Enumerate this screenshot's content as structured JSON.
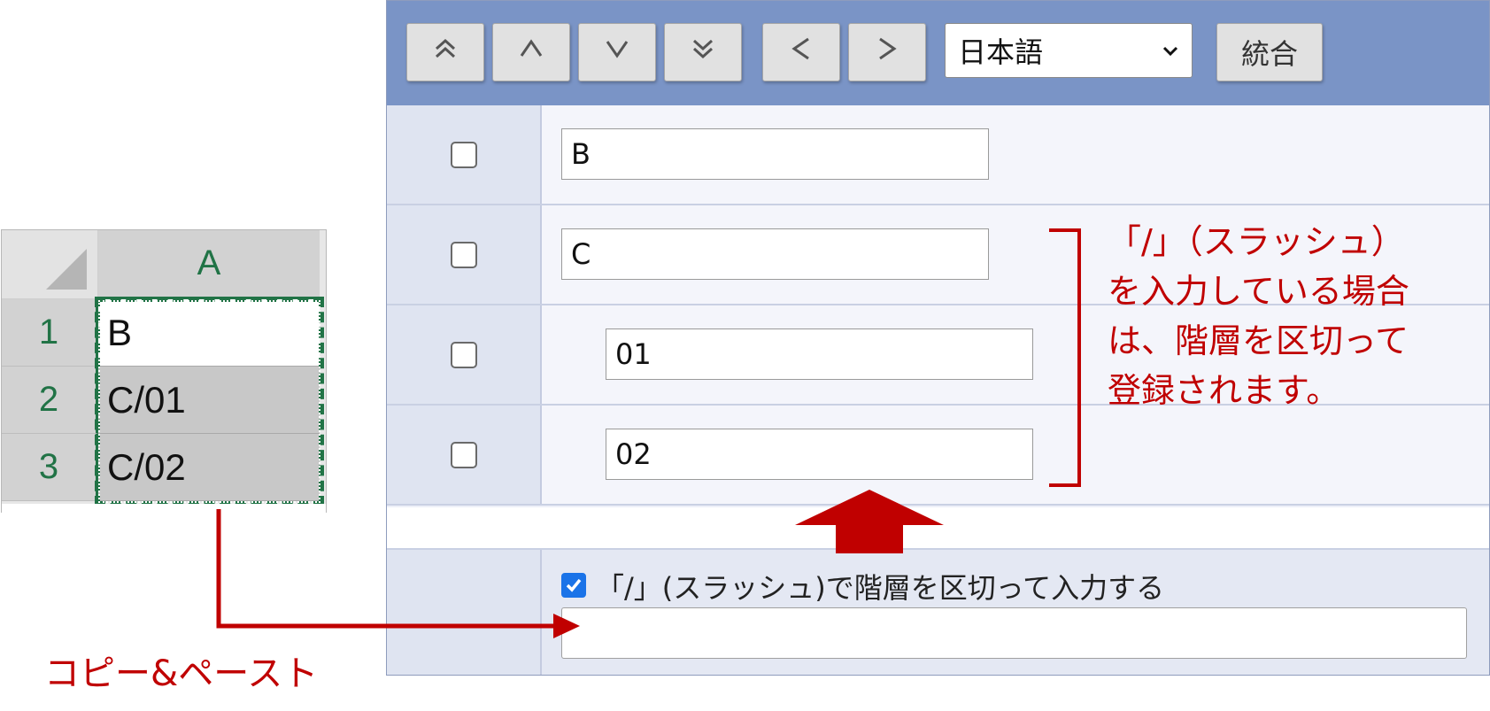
{
  "excel": {
    "column_header": "A",
    "rows": [
      {
        "number": "1",
        "value": "B"
      },
      {
        "number": "2",
        "value": "C/01"
      },
      {
        "number": "3",
        "value": "C/02"
      }
    ]
  },
  "toolbar": {
    "buttons": [
      {
        "icon": "double-chevron-up-icon"
      },
      {
        "icon": "chevron-up-icon"
      },
      {
        "icon": "chevron-down-icon"
      },
      {
        "icon": "double-chevron-down-icon"
      },
      {
        "icon": "chevron-left-icon"
      },
      {
        "icon": "chevron-right-icon"
      }
    ],
    "language_selected": "日本語",
    "merge_label": "統合"
  },
  "items": [
    {
      "value": "B",
      "level": 0,
      "checked": false
    },
    {
      "value": "C",
      "level": 0,
      "checked": false
    },
    {
      "value": "01",
      "level": 1,
      "checked": false
    },
    {
      "value": "02",
      "level": 1,
      "checked": false
    }
  ],
  "slash_option": {
    "label": "「/」(スラッシュ)で階層を区切って入力する",
    "checked": true,
    "input_value": ""
  },
  "annotations": {
    "note": "「/」（スラッシュ）\nを入力している場合\nは、階層を区切って\n登録されます。",
    "copy_paste": "コピー&ペースト"
  },
  "colors": {
    "toolbar_bg": "#7a94c6",
    "annotation_red": "#c00000",
    "excel_green": "#217346",
    "checkbox_blue": "#1a73e8"
  }
}
